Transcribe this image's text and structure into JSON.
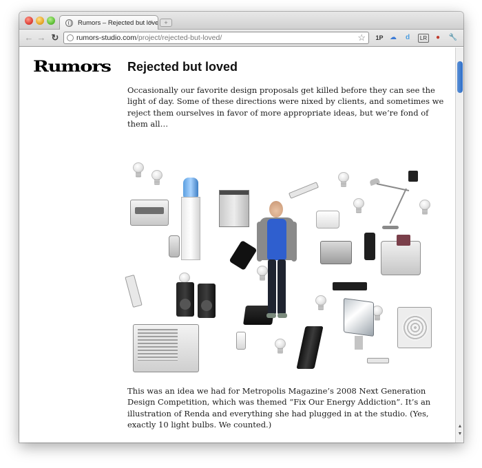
{
  "browser": {
    "tab_title": "Rumors – Rejected but loved",
    "tab_close_glyph": "×",
    "url_host": "rumors-studio.com",
    "url_path": "/project/rejected-but-loved/",
    "extensions": [
      "1P",
      "weather-icon",
      "d",
      "LR",
      "lips-icon",
      "wrench-icon"
    ],
    "ext_labels": {
      "onepassword": "1P",
      "d": "d",
      "lr": "LR"
    }
  },
  "page": {
    "logo": "Rumors",
    "title": "Rejected but loved",
    "intro": "Occasionally our favorite design proposals get killed before they can see the light of day. Some of these directions were nixed by clients, and sometimes we reject them ourselves in favor of more appropriate ideas, but we’re fond of them all…",
    "caption": "This was an idea we had for Metropolis Magazine’s 2008 Next Generation Design Competition, which was themed “Fix Our Energy Addiction”. It’s an illustration of Renda and everything she had plugged in at the studio. (Yes, exactly 10 light bulbs. We counted.)"
  }
}
